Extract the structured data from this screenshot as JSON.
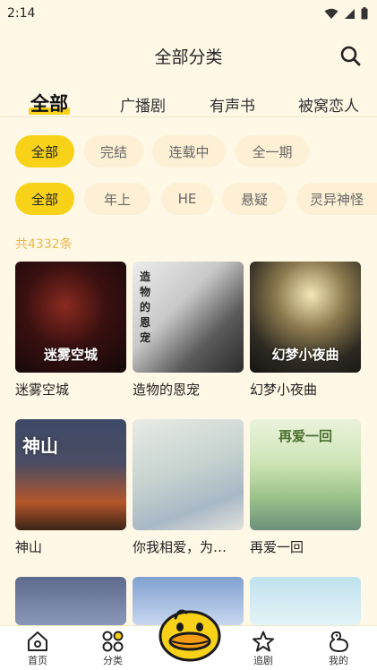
{
  "status_bar": {
    "time": "2:14"
  },
  "header": {
    "title": "全部分类"
  },
  "tabs": [
    {
      "label": "全部",
      "active": true
    },
    {
      "label": "广播剧",
      "active": false
    },
    {
      "label": "有声书",
      "active": false
    },
    {
      "label": "被窝恋人",
      "active": false
    }
  ],
  "filters_status": [
    {
      "label": "全部",
      "active": true
    },
    {
      "label": "完结",
      "active": false
    },
    {
      "label": "连载中",
      "active": false
    },
    {
      "label": "全一期",
      "active": false
    }
  ],
  "filters_genre": [
    {
      "label": "全部",
      "active": true
    },
    {
      "label": "年上",
      "active": false
    },
    {
      "label": "HE",
      "active": false
    },
    {
      "label": "悬疑",
      "active": false
    },
    {
      "label": "灵异神怪",
      "active": false
    }
  ],
  "count_text": "共4332条",
  "items": [
    {
      "name": "迷雾空城",
      "cover_text": "迷雾空城"
    },
    {
      "name": "造物的恩宠",
      "cover_text": "造物的恩宠"
    },
    {
      "name": "幻梦小夜曲",
      "cover_text": "幻梦小夜曲"
    },
    {
      "name": "神山",
      "cover_text": "神山"
    },
    {
      "name": "你我相爱，为…",
      "cover_text": ""
    },
    {
      "name": "再爱一回",
      "cover_text": "再爱一回"
    }
  ],
  "bottom_nav": [
    {
      "label": "首页",
      "icon": "home-icon"
    },
    {
      "label": "分类",
      "icon": "category-icon"
    },
    {
      "label": "追剧",
      "icon": "star-icon"
    },
    {
      "label": "我的",
      "icon": "duck-profile-icon"
    }
  ],
  "colors": {
    "accent": "#f7d219",
    "background": "#fff8e6",
    "count": "#e9b84a"
  }
}
